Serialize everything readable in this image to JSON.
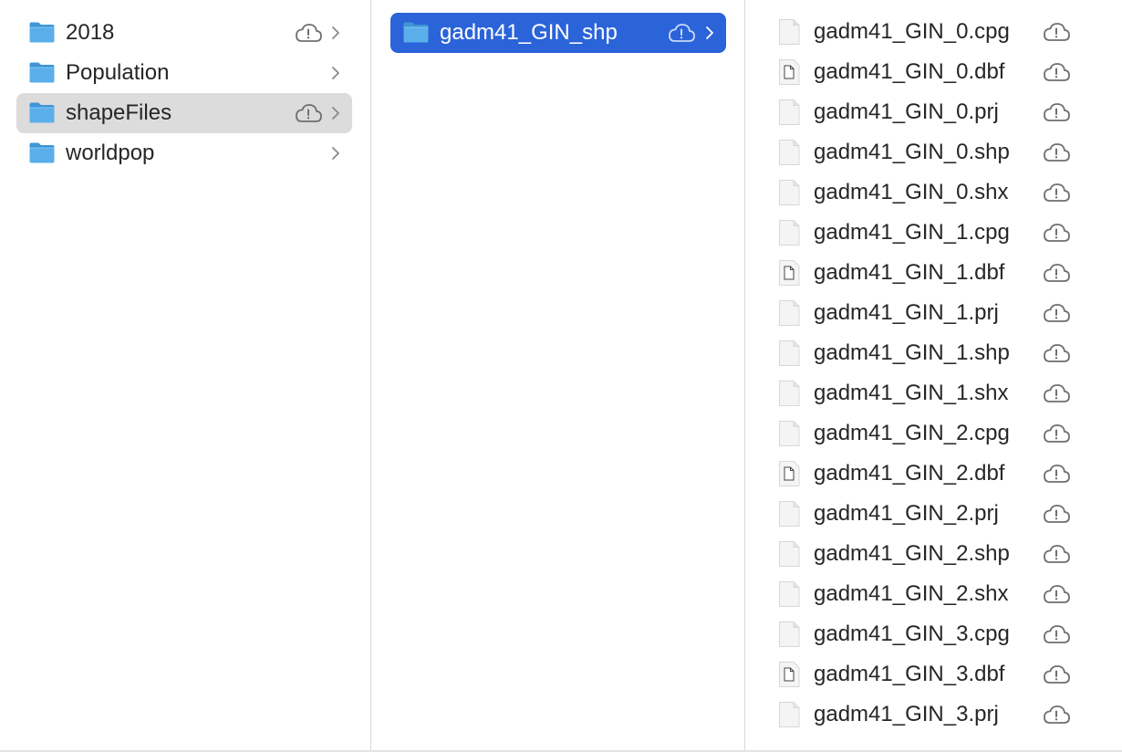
{
  "colors": {
    "selection": "#2b63d9",
    "highlight": "#dcdcdc",
    "folder": "#5aaeea",
    "text": "#262626",
    "icon_gray": "#6f6f6f"
  },
  "column1": {
    "items": [
      {
        "label": "2018",
        "icon": "folder-icon",
        "cloud": true,
        "chevron": true,
        "state": "normal"
      },
      {
        "label": "Population",
        "icon": "folder-icon",
        "cloud": false,
        "chevron": true,
        "state": "normal"
      },
      {
        "label": "shapeFiles",
        "icon": "folder-icon",
        "cloud": true,
        "chevron": true,
        "state": "highlighted"
      },
      {
        "label": "worldpop",
        "icon": "folder-icon",
        "cloud": false,
        "chevron": true,
        "state": "normal"
      }
    ]
  },
  "column2": {
    "items": [
      {
        "label": "gadm41_GIN_shp",
        "icon": "folder-icon",
        "cloud": true,
        "chevron": true,
        "state": "selected"
      }
    ]
  },
  "column3": {
    "files": [
      {
        "label": "gadm41_GIN_0.cpg",
        "icon": "document-icon"
      },
      {
        "label": "gadm41_GIN_0.dbf",
        "icon": "dbf-document-icon"
      },
      {
        "label": "gadm41_GIN_0.prj",
        "icon": "document-icon"
      },
      {
        "label": "gadm41_GIN_0.shp",
        "icon": "document-icon"
      },
      {
        "label": "gadm41_GIN_0.shx",
        "icon": "document-icon"
      },
      {
        "label": "gadm41_GIN_1.cpg",
        "icon": "document-icon"
      },
      {
        "label": "gadm41_GIN_1.dbf",
        "icon": "dbf-document-icon"
      },
      {
        "label": "gadm41_GIN_1.prj",
        "icon": "document-icon"
      },
      {
        "label": "gadm41_GIN_1.shp",
        "icon": "document-icon"
      },
      {
        "label": "gadm41_GIN_1.shx",
        "icon": "document-icon"
      },
      {
        "label": "gadm41_GIN_2.cpg",
        "icon": "document-icon"
      },
      {
        "label": "gadm41_GIN_2.dbf",
        "icon": "dbf-document-icon"
      },
      {
        "label": "gadm41_GIN_2.prj",
        "icon": "document-icon"
      },
      {
        "label": "gadm41_GIN_2.shp",
        "icon": "document-icon"
      },
      {
        "label": "gadm41_GIN_2.shx",
        "icon": "document-icon"
      },
      {
        "label": "gadm41_GIN_3.cpg",
        "icon": "document-icon"
      },
      {
        "label": "gadm41_GIN_3.dbf",
        "icon": "dbf-document-icon"
      },
      {
        "label": "gadm41_GIN_3.prj",
        "icon": "document-icon"
      }
    ]
  }
}
